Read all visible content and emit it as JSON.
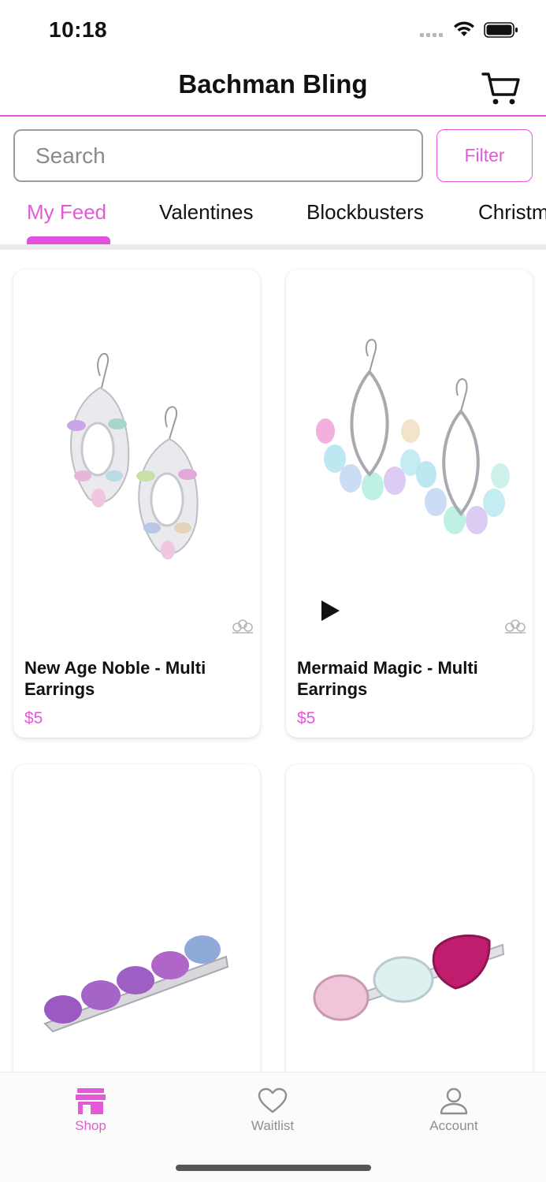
{
  "status_bar": {
    "time": "10:18"
  },
  "header": {
    "title": "Bachman Bling"
  },
  "search": {
    "placeholder": "Search",
    "value": ""
  },
  "filter": {
    "label": "Filter"
  },
  "tabs": [
    {
      "label": "My Feed",
      "active": true
    },
    {
      "label": "Valentines",
      "active": false
    },
    {
      "label": "Blockbusters",
      "active": false
    },
    {
      "label": "Christmas",
      "active": false
    }
  ],
  "products": [
    {
      "title": "New Age Noble - Multi Earrings",
      "price": "$5",
      "icon": "crown-icon"
    },
    {
      "title": "Mermaid Magic - Multi Earrings",
      "price": "$5",
      "icon": "crown-icon",
      "video": true
    },
    {
      "title": "",
      "price": ""
    },
    {
      "title": "",
      "price": ""
    }
  ],
  "bottom_nav": [
    {
      "label": "Shop",
      "icon": "store-icon",
      "active": true
    },
    {
      "label": "Waitlist",
      "icon": "heart-icon",
      "active": false
    },
    {
      "label": "Account",
      "icon": "user-icon",
      "active": false
    }
  ],
  "colors": {
    "accent": "#e35ad7",
    "text": "#111111",
    "muted": "#8f8f8f"
  }
}
